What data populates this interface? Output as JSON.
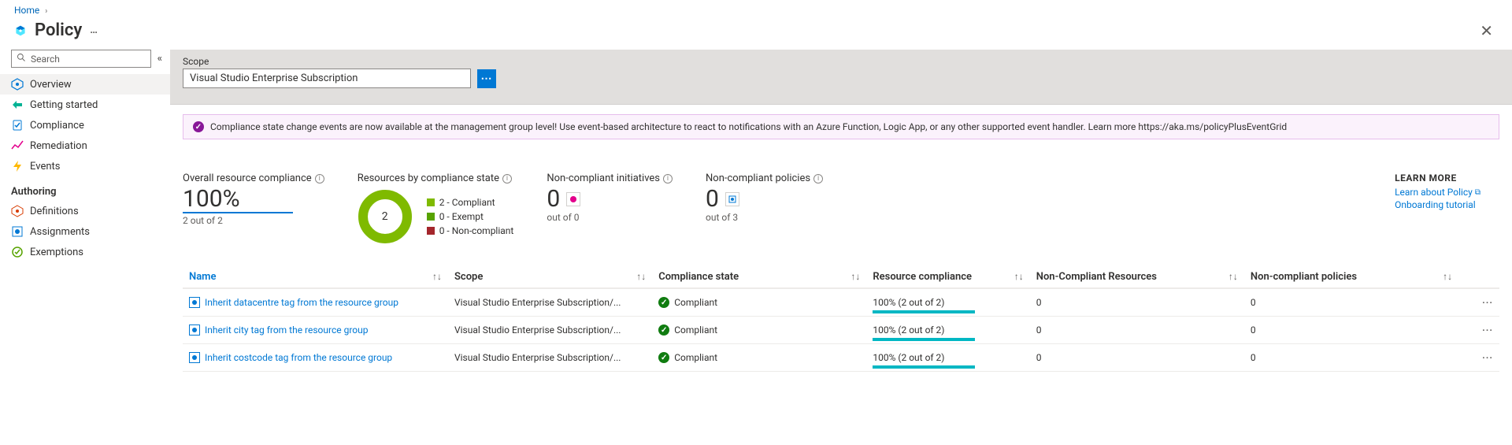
{
  "breadcrumb": {
    "home": "Home"
  },
  "header": {
    "title": "Policy"
  },
  "sidebar": {
    "search_placeholder": "Search",
    "items": [
      {
        "label": "Overview"
      },
      {
        "label": "Getting started"
      },
      {
        "label": "Compliance"
      },
      {
        "label": "Remediation"
      },
      {
        "label": "Events"
      }
    ],
    "authoring_label": "Authoring",
    "authoring": [
      {
        "label": "Definitions"
      },
      {
        "label": "Assignments"
      },
      {
        "label": "Exemptions"
      }
    ]
  },
  "scope": {
    "label": "Scope",
    "value": "Visual Studio Enterprise Subscription"
  },
  "banner": {
    "text": "Compliance state change events are now available at the management group level! Use event-based architecture to react to notifications with an Azure Function, Logic App, or any other supported event handler. Learn more https://aka.ms/policyPlusEventGrid"
  },
  "stats": {
    "overall": {
      "title": "Overall resource compliance",
      "value": "100%",
      "sub": "2 out of 2"
    },
    "byState": {
      "title": "Resources by compliance state",
      "total": "2",
      "legend": {
        "compliant": "2 - Compliant",
        "exempt": "0 - Exempt",
        "noncompliant": "0 - Non-compliant"
      }
    },
    "nci": {
      "title": "Non-compliant initiatives",
      "value": "0",
      "sub": "out of 0"
    },
    "ncp": {
      "title": "Non-compliant policies",
      "value": "0",
      "sub": "out of 3"
    }
  },
  "learn": {
    "header": "LEARN MORE",
    "links": {
      "about": "Learn about Policy",
      "onboarding": "Onboarding tutorial"
    }
  },
  "table": {
    "headers": {
      "name": "Name",
      "scope": "Scope",
      "compliance_state": "Compliance state",
      "resource_compliance": "Resource compliance",
      "nc_resources": "Non-Compliant Resources",
      "nc_policies": "Non-compliant policies"
    },
    "rows": [
      {
        "name": "Inherit datacentre tag from the resource group",
        "scope": "Visual Studio Enterprise Subscription/...",
        "state": "Compliant",
        "rc": "100% (2 out of 2)",
        "ncr": "0",
        "ncp": "0"
      },
      {
        "name": "Inherit city tag from the resource group",
        "scope": "Visual Studio Enterprise Subscription/...",
        "state": "Compliant",
        "rc": "100% (2 out of 2)",
        "ncr": "0",
        "ncp": "0"
      },
      {
        "name": "Inherit costcode tag from the resource group",
        "scope": "Visual Studio Enterprise Subscription/...",
        "state": "Compliant",
        "rc": "100% (2 out of 2)",
        "ncr": "0",
        "ncp": "0"
      }
    ]
  },
  "chart_data": {
    "type": "pie",
    "title": "Resources by compliance state",
    "categories": [
      "Compliant",
      "Exempt",
      "Non-compliant"
    ],
    "values": [
      2,
      0,
      0
    ],
    "colors": [
      "#7fba00",
      "#57a300",
      "#A4262C"
    ]
  }
}
